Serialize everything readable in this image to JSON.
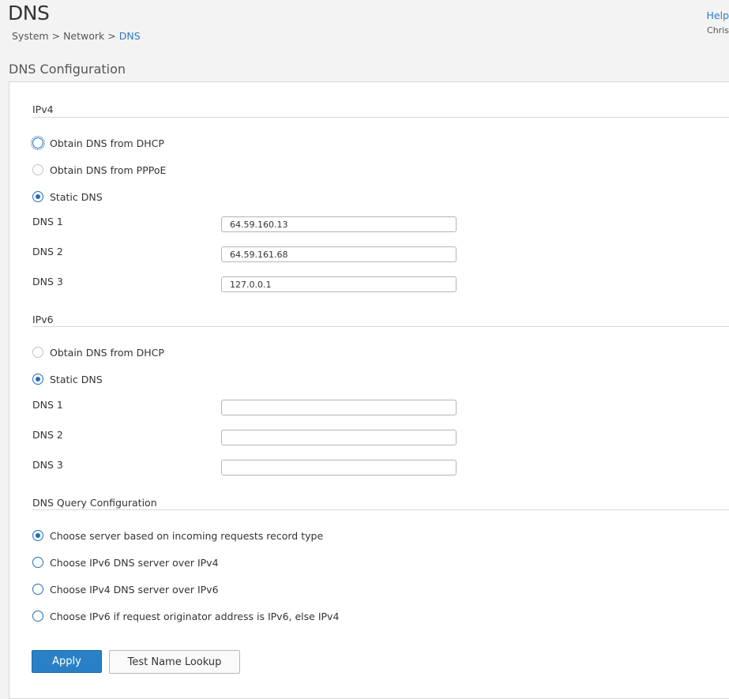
{
  "header": {
    "title": "DNS",
    "breadcrumb": {
      "system": "System",
      "network": "Network",
      "current": "DNS",
      "separator": ">"
    },
    "help": "Help",
    "user": "Chris"
  },
  "section_title": "DNS Configuration",
  "ipv4": {
    "header": "IPv4",
    "options": [
      {
        "label": "Obtain DNS from DHCP",
        "checked": false
      },
      {
        "label": "Obtain DNS from PPPoE",
        "checked": false,
        "disabled": true
      },
      {
        "label": "Static DNS",
        "checked": true
      }
    ],
    "dns1_label": "DNS 1",
    "dns1_value": "64.59.160.13",
    "dns2_label": "DNS 2",
    "dns2_value": "64.59.161.68",
    "dns3_label": "DNS 3",
    "dns3_value": "127.0.0.1"
  },
  "ipv6": {
    "header": "IPv6",
    "options": [
      {
        "label": "Obtain DNS from DHCP",
        "checked": false,
        "disabled": true
      },
      {
        "label": "Static DNS",
        "checked": true
      }
    ],
    "dns1_label": "DNS 1",
    "dns1_value": "",
    "dns2_label": "DNS 2",
    "dns2_value": "",
    "dns3_label": "DNS 3",
    "dns3_value": ""
  },
  "query": {
    "header": "DNS Query Configuration",
    "options": [
      {
        "label": "Choose server based on incoming requests record type",
        "checked": true
      },
      {
        "label": "Choose IPv6 DNS server over IPv4",
        "checked": false
      },
      {
        "label": "Choose IPv4 DNS server over IPv6",
        "checked": false
      },
      {
        "label": "Choose IPv6 if request originator address is IPv6, else IPv4",
        "checked": false
      }
    ]
  },
  "buttons": {
    "apply": "Apply",
    "test": "Test Name Lookup"
  },
  "colors": {
    "accent": "#2a80c6",
    "link": "#2f7bbf"
  }
}
